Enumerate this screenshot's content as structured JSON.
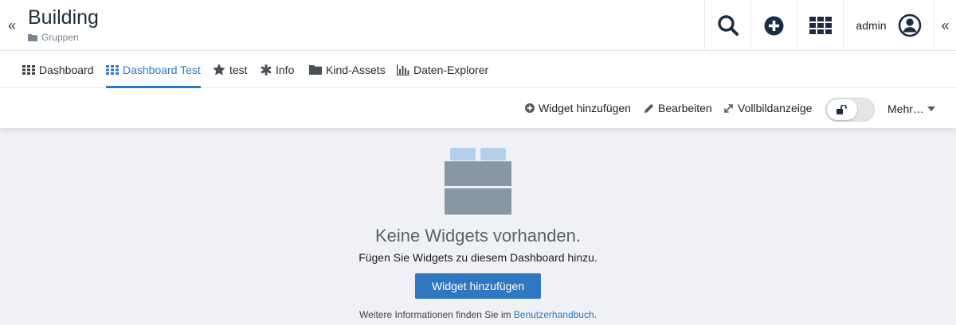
{
  "header": {
    "collapse_left": "«",
    "title": "Building",
    "breadcrumb": "Gruppen",
    "user_name": "admin",
    "collapse_right": "«"
  },
  "tabs": [
    {
      "label": "Dashboard",
      "icon": "grid-icon"
    },
    {
      "label": "Dashboard Test",
      "icon": "grid-icon",
      "active": true
    },
    {
      "label": "test",
      "icon": "star-icon"
    },
    {
      "label": "Info",
      "icon": "asterisk-icon"
    },
    {
      "label": "Kind-Assets",
      "icon": "folder-icon"
    },
    {
      "label": "Daten-Explorer",
      "icon": "bar-chart-icon"
    }
  ],
  "toolbar": {
    "add_widget": "Widget hinzufügen",
    "edit": "Bearbeiten",
    "fullscreen": "Vollbildanzeige",
    "more": "Mehr…"
  },
  "empty_state": {
    "title": "Keine Widgets vorhanden.",
    "subtitle": "Fügen Sie Widgets zu diesem Dashboard hinzu.",
    "button": "Widget hinzufügen",
    "help_prefix": "Weitere Informationen finden Sie im ",
    "help_link": "Benutzerhandbuch",
    "help_suffix": "."
  },
  "colors": {
    "accent": "#2f78c0",
    "illustration_gray": "#8797a6",
    "illustration_light_blue": "#b2d0eb"
  }
}
